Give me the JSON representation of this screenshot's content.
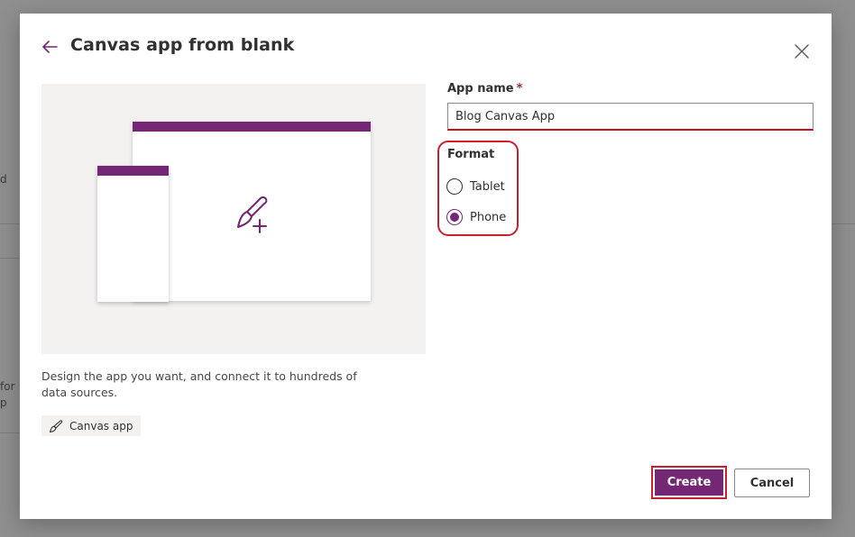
{
  "background": {
    "fragments": [
      "d",
      "for",
      "p"
    ]
  },
  "dialog": {
    "title": "Canvas app from blank",
    "back_icon": "arrow-left-icon",
    "close_icon": "close-icon",
    "description": "Design the app you want, and connect it to hundreds of data sources.",
    "tag": {
      "label": "Canvas app",
      "icon": "brush-icon"
    },
    "form": {
      "app_name": {
        "label": "App name",
        "required_marker": "*",
        "value": "Blog Canvas App"
      },
      "format": {
        "label": "Format",
        "options": [
          {
            "label": "Tablet",
            "selected": false
          },
          {
            "label": "Phone",
            "selected": true
          }
        ]
      }
    },
    "buttons": {
      "create": "Create",
      "cancel": "Cancel"
    }
  },
  "colors": {
    "accent": "#742774",
    "highlight": "#c8202f",
    "required": "#a4262c"
  }
}
